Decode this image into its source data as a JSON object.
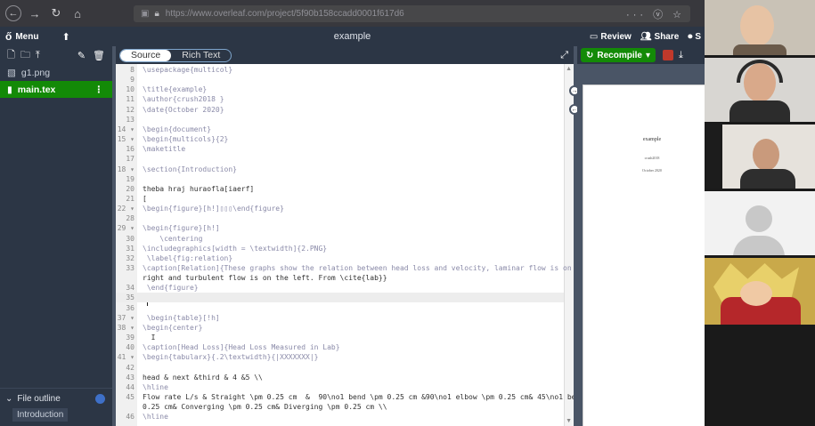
{
  "browser": {
    "url": "https://www.overleaf.com/project/5f90b158ccadd0001f617d6",
    "back_icon": "arrow-left",
    "forward_icon": "arrow-right",
    "reload_icon": "reload",
    "home_icon": "home",
    "right_icons": "··· ⓥ ☆"
  },
  "header": {
    "menu_label": "Menu",
    "project_title": "example",
    "review_label": "Review",
    "share_label": "Share",
    "submit_label": "S"
  },
  "sidebar": {
    "files": [
      {
        "name": "g1.png",
        "icon": "image-icon"
      },
      {
        "name": "main.tex",
        "icon": "file-icon",
        "active": true
      }
    ],
    "file_outline_label": "File outline",
    "outline_items": [
      "Introduction"
    ]
  },
  "editor": {
    "source_label": "Source",
    "rich_text_label": "Rich Text",
    "lines": [
      {
        "n": "8",
        "code": "\\usepackage{multicol}"
      },
      {
        "n": "9",
        "code": ""
      },
      {
        "n": "10",
        "code": "\\title{example}"
      },
      {
        "n": "11",
        "code": "\\author{crush2018 }"
      },
      {
        "n": "12",
        "code": "\\date{October 2020}"
      },
      {
        "n": "13",
        "code": ""
      },
      {
        "n": "14 ▾",
        "code": "\\begin{document}"
      },
      {
        "n": "15 ▾",
        "code": "\\begin{multicols}{2}"
      },
      {
        "n": "16",
        "code": "\\maketitle"
      },
      {
        "n": "17",
        "code": ""
      },
      {
        "n": "18 ▾",
        "code": "\\section{Introduction}"
      },
      {
        "n": "19",
        "code": ""
      },
      {
        "n": "20",
        "code": "theba hraj huraofla[iaerf]"
      },
      {
        "n": "21",
        "code": "["
      },
      {
        "n": "22 ▾",
        "code": "\\begin{figure}[h!]▯▯▯\\end{figure}"
      },
      {
        "n": "28",
        "code": ""
      },
      {
        "n": "29 ▾",
        "code": "\\begin{figure}[h!]"
      },
      {
        "n": "30",
        "code": "    \\centering"
      },
      {
        "n": "31",
        "code": "\\includegraphics[width = \\textwidth]{2.PNG}"
      },
      {
        "n": "32",
        "code": " \\label{fig:relation}"
      },
      {
        "n": "33",
        "code": "\\caption[Relation]{These graphs show the relation between head loss and velocity, laminar flow is on the"
      },
      {
        "n": "",
        "code": "right and turbulent flow is on the left. From \\cite{lab}}"
      },
      {
        "n": "34",
        "code": " \\end{figure}"
      },
      {
        "n": "35",
        "code": ""
      },
      {
        "n": "36",
        "code": ""
      },
      {
        "n": "37 ▾",
        "code": " \\begin{table}[!h]"
      },
      {
        "n": "38 ▾",
        "code": "\\begin{center}"
      },
      {
        "n": "39",
        "code": "  I"
      },
      {
        "n": "40",
        "code": "\\caption[Head Loss]{Head Loss Measured in Lab}"
      },
      {
        "n": "41 ▾",
        "code": "\\begin{tabularx}{.2\\textwidth}{|XXXXXXX|}"
      },
      {
        "n": "42",
        "code": ""
      },
      {
        "n": "43",
        "code": "head & next &third & 4 &5 \\\\"
      },
      {
        "n": "44",
        "code": "\\hline"
      },
      {
        "n": "45",
        "code": "Flow rate L/s & Straight \\pm 0.25 cm  &  90\\no1 bend \\pm 0.25 cm &90\\no1 elbow \\pm 0.25 cm& 45\\no1 bend  \\pm"
      },
      {
        "n": "",
        "code": "0.25 cm& Converging \\pm 0.25 cm& Diverging \\pm 0.25 cm \\\\"
      },
      {
        "n": "46",
        "code": "\\hline"
      }
    ]
  },
  "pdf": {
    "recompile_label": "Recompile",
    "title": "example",
    "author": "crush2018",
    "date": "October 2020"
  },
  "colors": {
    "header_bg": "#2c3645",
    "accent_green": "#138a07",
    "editor_bg": "#ffffff"
  }
}
